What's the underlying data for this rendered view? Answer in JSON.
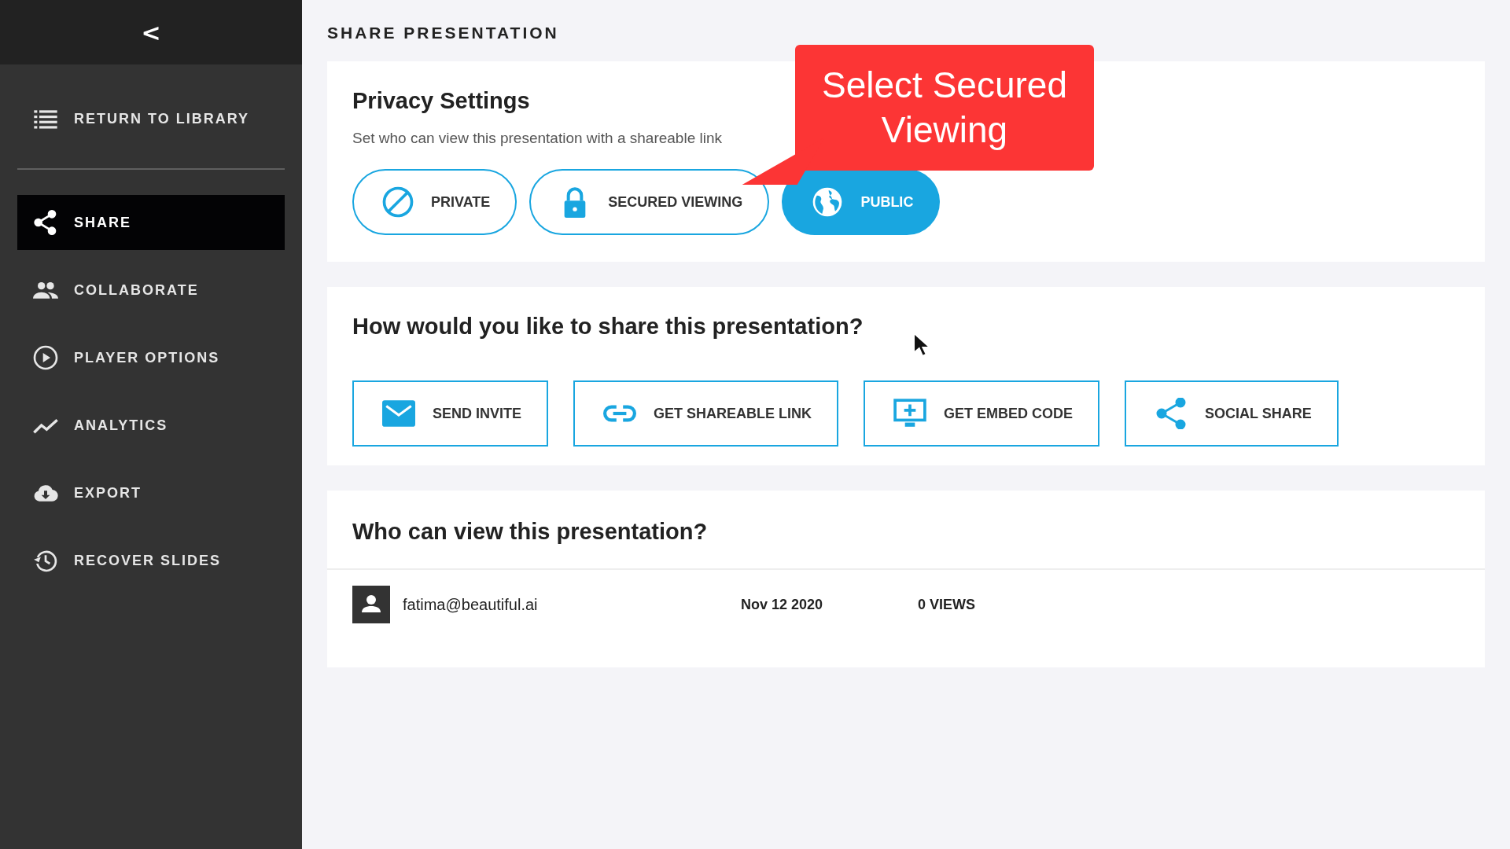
{
  "sidebar": {
    "back_label": "<",
    "return_item": {
      "label": "RETURN TO LIBRARY"
    },
    "items": [
      {
        "label": "SHARE",
        "selected": true
      },
      {
        "label": "COLLABORATE",
        "selected": false
      },
      {
        "label": "PLAYER OPTIONS",
        "selected": false
      },
      {
        "label": "ANALYTICS",
        "selected": false
      },
      {
        "label": "EXPORT",
        "selected": false
      },
      {
        "label": "RECOVER SLIDES",
        "selected": false
      }
    ]
  },
  "page_title": "SHARE PRESENTATION",
  "privacy": {
    "title": "Privacy Settings",
    "subtitle": "Set who can view this presentation with a shareable link",
    "options": [
      {
        "label": "PRIVATE",
        "selected": false
      },
      {
        "label": "SECURED VIEWING",
        "selected": false
      },
      {
        "label": "PUBLIC",
        "selected": true
      }
    ]
  },
  "callout": {
    "text": "Select Secured Viewing"
  },
  "share": {
    "title": "How would you like to share this presentation?",
    "buttons": [
      {
        "label": "SEND INVITE"
      },
      {
        "label": "GET SHAREABLE LINK"
      },
      {
        "label": "GET EMBED CODE"
      },
      {
        "label": "SOCIAL SHARE"
      }
    ]
  },
  "viewers": {
    "title": "Who can view this presentation?",
    "rows": [
      {
        "email": "fatima@beautiful.ai",
        "date": "Nov 12 2020",
        "views": "0 VIEWS"
      }
    ]
  }
}
